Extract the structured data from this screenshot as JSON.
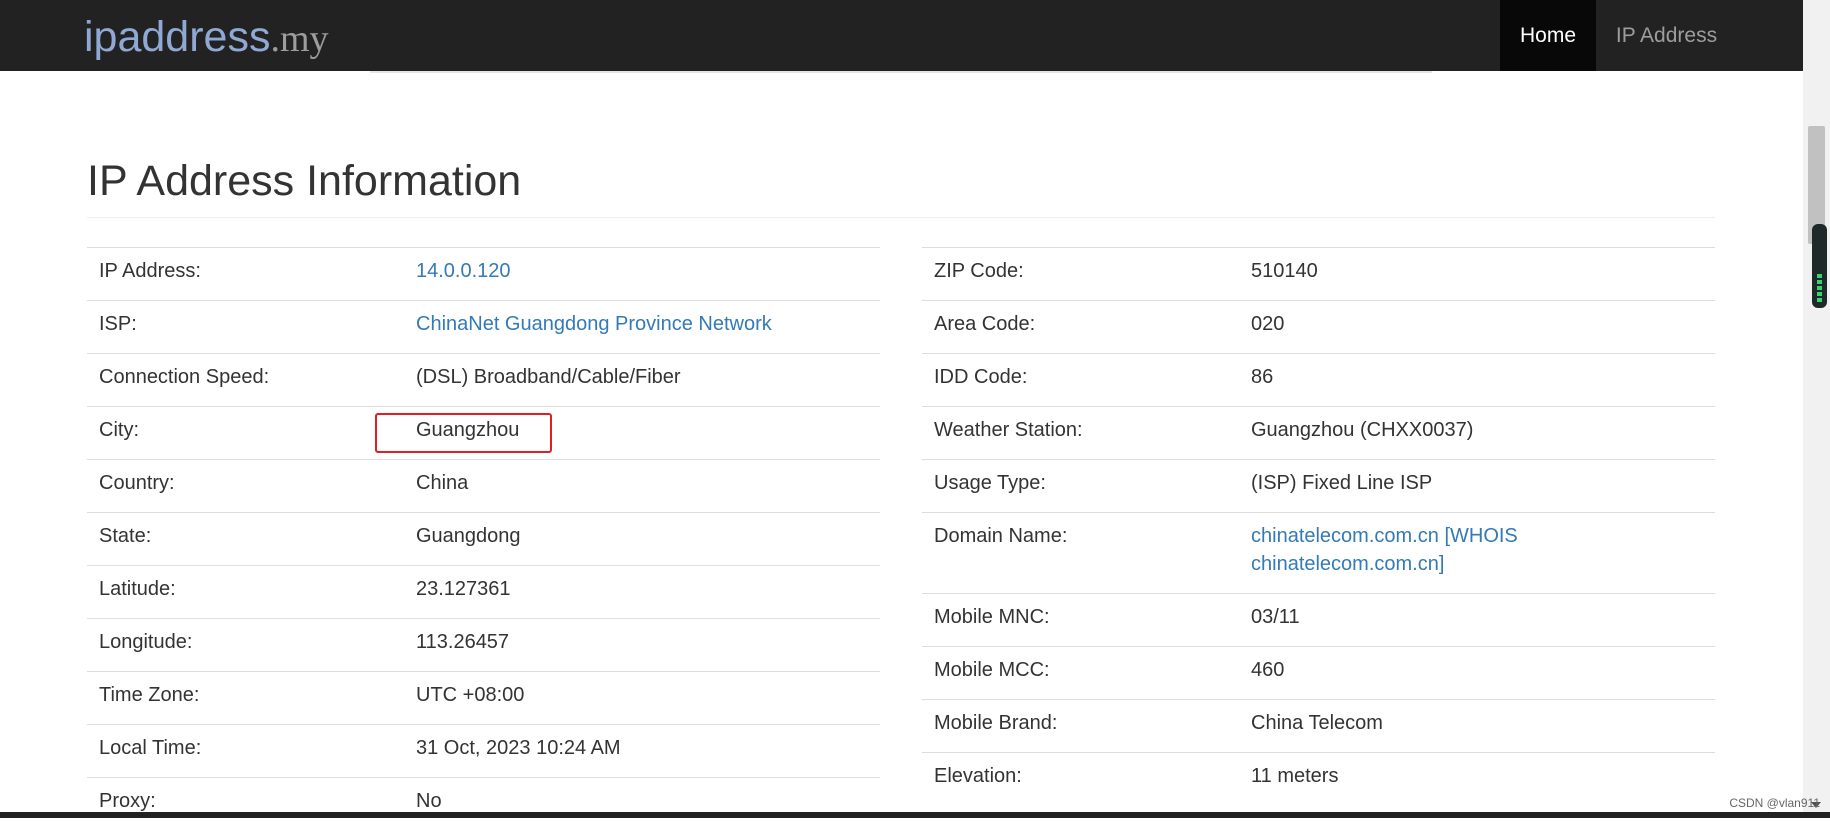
{
  "navbar": {
    "brand_name": "ipaddress",
    "brand_tld": ".my",
    "items": [
      {
        "label": "Home",
        "active": true
      },
      {
        "label": "IP Address",
        "active": false
      }
    ]
  },
  "page": {
    "title": "IP Address Information"
  },
  "left_table": [
    {
      "label": "IP Address:",
      "value": "14.0.0.120",
      "link": true
    },
    {
      "label": "ISP:",
      "value": "ChinaNet Guangdong Province Network",
      "link": true
    },
    {
      "label": "Connection Speed:",
      "value": "(DSL) Broadband/Cable/Fiber",
      "link": false
    },
    {
      "label": "City:",
      "value": "Guangzhou",
      "link": false
    },
    {
      "label": "Country:",
      "value": "China",
      "link": false
    },
    {
      "label": "State:",
      "value": "Guangdong",
      "link": false
    },
    {
      "label": "Latitude:",
      "value": "23.127361",
      "link": false
    },
    {
      "label": "Longitude:",
      "value": "113.26457",
      "link": false
    },
    {
      "label": "Time Zone:",
      "value": "UTC +08:00",
      "link": false
    },
    {
      "label": "Local Time:",
      "value": "31 Oct, 2023 10:24 AM",
      "link": false
    },
    {
      "label": "Proxy:",
      "value": "No",
      "link": false
    }
  ],
  "right_table": [
    {
      "label": "ZIP Code:",
      "value": "510140",
      "link": false
    },
    {
      "label": "Area Code:",
      "value": "020",
      "link": false
    },
    {
      "label": "IDD Code:",
      "value": "86",
      "link": false
    },
    {
      "label": "Weather Station:",
      "value": "Guangzhou (CHXX0037)",
      "link": false
    },
    {
      "label": "Usage Type:",
      "value": "(ISP) Fixed Line ISP",
      "link": false
    },
    {
      "label": "Domain Name:",
      "value": "chinatelecom.com.cn",
      "value_suffix": "[WHOIS chinatelecom.com.cn]",
      "link": true
    },
    {
      "label": "Mobile MNC:",
      "value": "03/11",
      "link": false
    },
    {
      "label": "Mobile MCC:",
      "value": "460",
      "link": false
    },
    {
      "label": "Mobile Brand:",
      "value": "China Telecom",
      "link": false
    },
    {
      "label": "Elevation:",
      "value": "11 meters",
      "link": false
    }
  ],
  "watermark": "CSDN @vlan911",
  "colors": {
    "navbar_bg": "#222222",
    "brand": "#8fa9d4",
    "link": "#337ab7",
    "highlight_box": "#e02020"
  }
}
